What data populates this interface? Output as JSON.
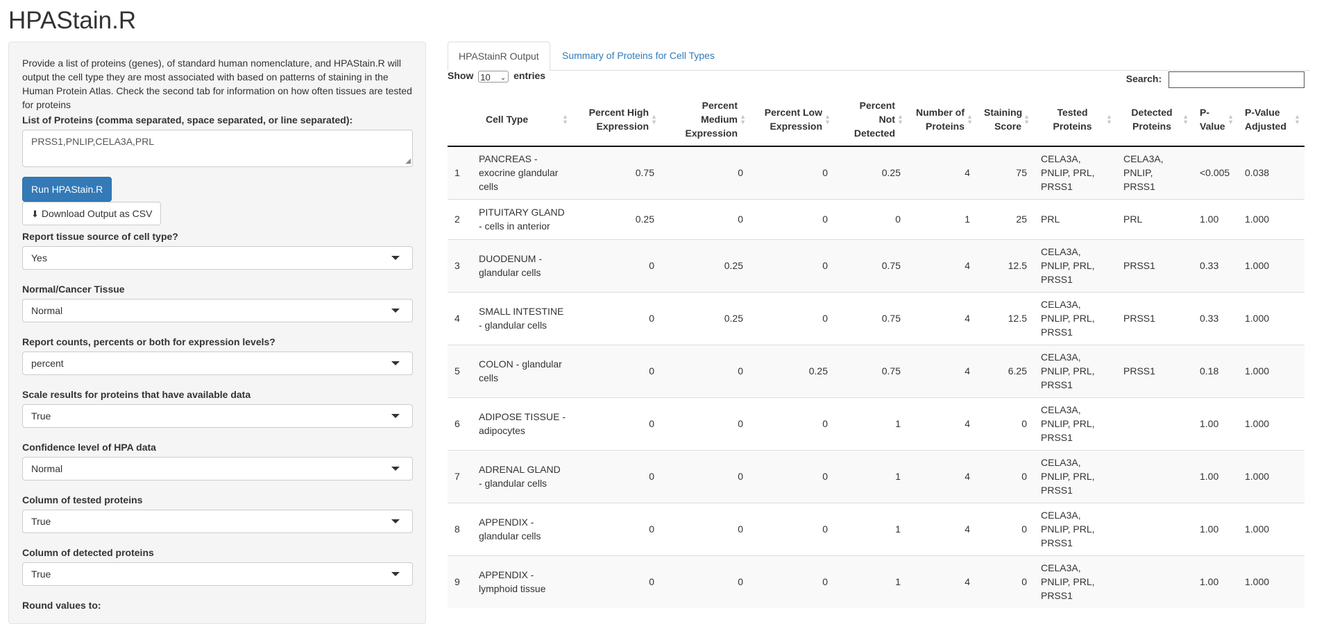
{
  "app": {
    "title": "HPAStain.R"
  },
  "sidebar": {
    "intro": "Provide a list of proteins (genes), of standard human nomenclature, and HPAStain.R will output the cell type they are most associated with based on patterns of staining in the Human Protein Atlas. Check the second tab for information on how often tissues are tested for proteins",
    "proteins_label": "List of Proteins (comma separated, space separated, or line separated):",
    "proteins_value": "PRSS1,PNLIP,CELA3A,PRL",
    "run_button": "Run HPAStain.R",
    "download_button": "Download Output as CSV",
    "fields": [
      {
        "label": "Report tissue source of cell type?",
        "value": "Yes"
      },
      {
        "label": "Normal/Cancer Tissue",
        "value": "Normal"
      },
      {
        "label": "Report counts, percents or both for expression levels?",
        "value": "percent"
      },
      {
        "label": "Scale results for proteins that have available data",
        "value": "True"
      },
      {
        "label": "Confidence level of HPA data",
        "value": "Normal"
      },
      {
        "label": "Column of tested proteins",
        "value": "True"
      },
      {
        "label": "Column of detected proteins",
        "value": "True"
      }
    ],
    "cutoff_label": "Round values to:"
  },
  "tabs": [
    {
      "label": "HPAStainR Output",
      "active": true
    },
    {
      "label": "Summary of Proteins for Cell Types",
      "active": false
    }
  ],
  "table_controls": {
    "show": "Show",
    "length": "10",
    "entries": "entries",
    "search_label": "Search:"
  },
  "columns": [
    "",
    "Cell Type",
    "Percent High Expression",
    "Percent Medium Expression",
    "Percent Low Expression",
    "Percent Not Detected",
    "Number of Proteins",
    "Staining Score",
    "Tested Proteins",
    "Detected Proteins",
    "P-Value",
    "P-Value Adjusted"
  ],
  "rows": [
    [
      "1",
      "PANCREAS - exocrine glandular cells",
      "0.75",
      "0",
      "0",
      "0.25",
      "4",
      "75",
      "CELA3A, PNLIP, PRL, PRSS1",
      "CELA3A, PNLIP, PRSS1",
      "<0.005",
      "0.038"
    ],
    [
      "2",
      "PITUITARY GLAND - cells in anterior",
      "0.25",
      "0",
      "0",
      "0",
      "1",
      "25",
      "PRL",
      "PRL",
      "1.00",
      "1.000"
    ],
    [
      "3",
      "DUODENUM - glandular cells",
      "0",
      "0.25",
      "0",
      "0.75",
      "4",
      "12.5",
      "CELA3A, PNLIP, PRL, PRSS1",
      "PRSS1",
      "0.33",
      "1.000"
    ],
    [
      "4",
      "SMALL INTESTINE - glandular cells",
      "0",
      "0.25",
      "0",
      "0.75",
      "4",
      "12.5",
      "CELA3A, PNLIP, PRL, PRSS1",
      "PRSS1",
      "0.33",
      "1.000"
    ],
    [
      "5",
      "COLON - glandular cells",
      "0",
      "0",
      "0.25",
      "0.75",
      "4",
      "6.25",
      "CELA3A, PNLIP, PRL, PRSS1",
      "PRSS1",
      "0.18",
      "1.000"
    ],
    [
      "6",
      "ADIPOSE TISSUE - adipocytes",
      "0",
      "0",
      "0",
      "1",
      "4",
      "0",
      "CELA3A, PNLIP, PRL, PRSS1",
      "",
      "1.00",
      "1.000"
    ],
    [
      "7",
      "ADRENAL GLAND - glandular cells",
      "0",
      "0",
      "0",
      "1",
      "4",
      "0",
      "CELA3A, PNLIP, PRL, PRSS1",
      "",
      "1.00",
      "1.000"
    ],
    [
      "8",
      "APPENDIX - glandular cells",
      "0",
      "0",
      "0",
      "1",
      "4",
      "0",
      "CELA3A, PNLIP, PRL, PRSS1",
      "",
      "1.00",
      "1.000"
    ],
    [
      "9",
      "APPENDIX - lymphoid tissue",
      "0",
      "0",
      "0",
      "1",
      "4",
      "0",
      "CELA3A, PNLIP, PRL, PRSS1",
      "",
      "1.00",
      "1.000"
    ]
  ]
}
